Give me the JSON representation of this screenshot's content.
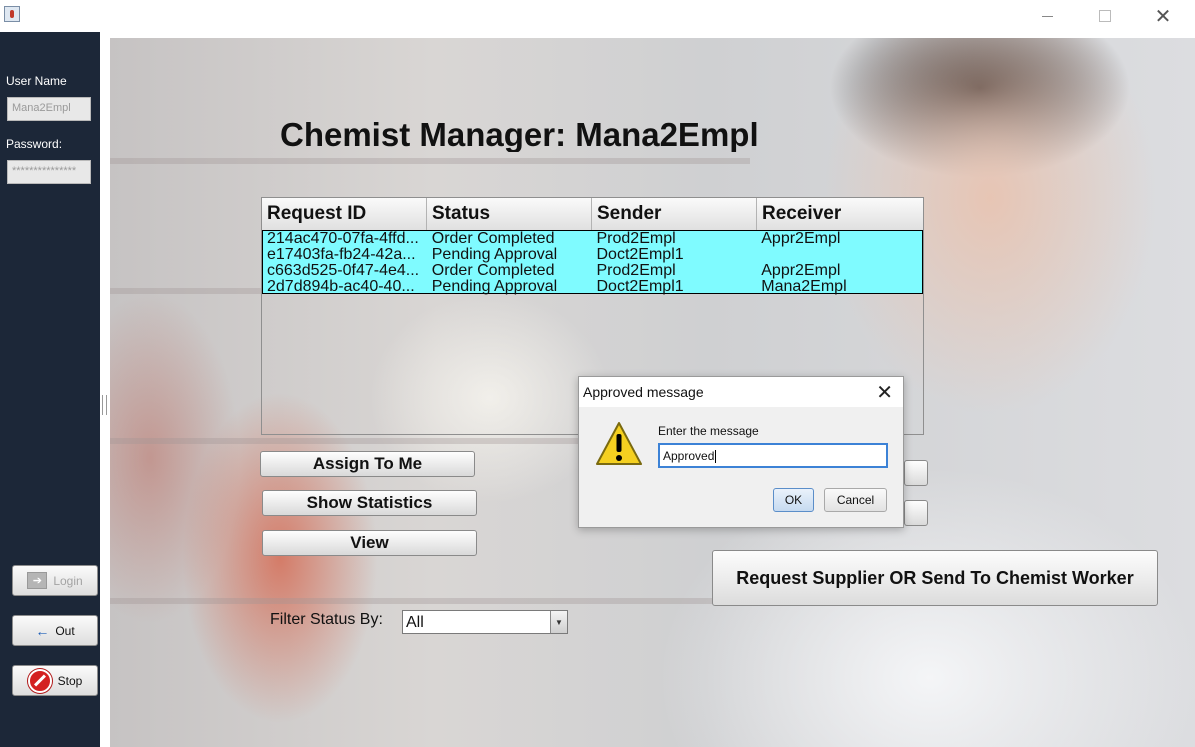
{
  "window": {
    "title": ""
  },
  "sidebar": {
    "username_label": "User Name",
    "username_value": "Mana2Empl",
    "password_label": "Password:",
    "password_value": "***************",
    "login_label": "Login",
    "out_label": "Out",
    "stop_label": "Stop"
  },
  "main": {
    "title": "Chemist Manager: Mana2Empl",
    "table": {
      "columns": [
        "Request ID",
        "Status",
        "Sender",
        "Receiver"
      ],
      "rows": [
        [
          "214ac470-07fa-4ffd...",
          "Order Completed",
          "Prod2Empl",
          "Appr2Empl"
        ],
        [
          "e17403fa-fb24-42a...",
          "Pending Approval",
          "Doct2Empl1",
          ""
        ],
        [
          "c663d525-0f47-4e4...",
          "Order Completed",
          "Prod2Empl",
          "Appr2Empl"
        ],
        [
          "2d7d894b-ac40-40...",
          "Pending Approval",
          "Doct2Empl1",
          "Mana2Empl"
        ]
      ],
      "row_color": "#7ffbff"
    },
    "buttons": {
      "assign": "Assign To Me",
      "statistics": "Show Statistics",
      "view": "View",
      "request_supplier": "Request Supplier OR Send To Chemist Worker"
    },
    "filter": {
      "label": "Filter Status By:",
      "selected": "All"
    }
  },
  "dialog": {
    "title": "Approved message",
    "prompt": "Enter the message",
    "input_value": "Approved",
    "ok_label": "OK",
    "cancel_label": "Cancel",
    "icon": "warning-icon"
  }
}
